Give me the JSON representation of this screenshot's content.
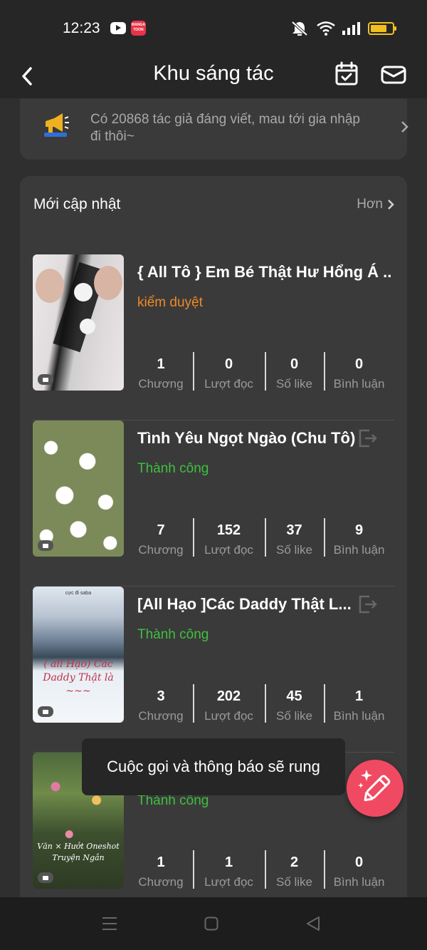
{
  "status_bar": {
    "time": "12:23",
    "manga_badge": "MANGA TOON"
  },
  "header": {
    "title": "Khu sáng tác"
  },
  "announcement": {
    "text": "Có 20868 tác giả đáng viết, mau tới gia nhập đi thôi~"
  },
  "updates": {
    "title": "Mới cập nhật",
    "more_label": "Hơn",
    "stat_labels": {
      "chapters": "Chương",
      "reads": "Lượt đọc",
      "likes": "Số like",
      "comments": "Bình luận"
    },
    "stories": [
      {
        "title": "{ All Tô } Em Bé Thật Hư Hổng Á ...",
        "status": "kiểm duyệt",
        "chapters": "1",
        "reads": "0",
        "likes": "0",
        "comments": "0"
      },
      {
        "title": "Tình Yêu Ngọt Ngào (Chu Tô)",
        "status": "Thành công",
        "chapters": "7",
        "reads": "152",
        "likes": "37",
        "comments": "9"
      },
      {
        "title": "[All Hạo ]Các Daddy Thật L...",
        "status": "Thành công",
        "chapters": "3",
        "reads": "202",
        "likes": "45",
        "comments": "1",
        "cover_top_text": "cực đi saba",
        "cover_text": "( all Hạo) Các Daddy Thật là ~~~"
      },
      {
        "title": "",
        "status": "Thành công",
        "chapters": "1",
        "reads": "1",
        "likes": "2",
        "comments": "0",
        "cover_text": "Văn × Hưởt Oneshot Truyện Ngắn"
      }
    ]
  },
  "toast": {
    "text": "Cuộc gọi và thông báo sẽ rung"
  },
  "colors": {
    "review": "#f08a24",
    "success": "#3fbf3f",
    "fab": "#f04a62"
  }
}
